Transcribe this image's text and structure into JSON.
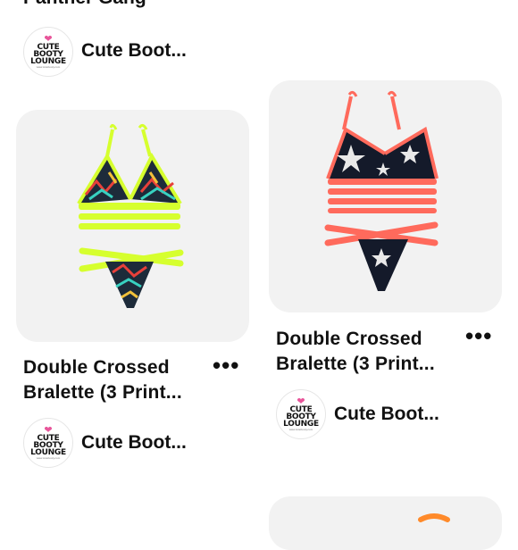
{
  "top_partial_title": "Panther Gang",
  "pins": [
    {
      "title_line1": "Double Crossed",
      "title_line2": "Bralette (3 Print...",
      "more_label": "•••",
      "accent": "#d6ff2e"
    },
    {
      "title_line1": "Double Crossed",
      "title_line2": "Bralette (3 Print...",
      "more_label": "•••",
      "accent": "#ff6a5c"
    }
  ],
  "brand": {
    "name": "Cute Boot...",
    "avatar_line1": "CUTE",
    "avatar_line2": "BOOTY",
    "avatar_line3": "LOUNGE",
    "avatar_heart": "❤",
    "avatar_url_text": "www.cutebooty.com"
  },
  "colors": {
    "card_bg": "#f2f2f2",
    "neon_yellow": "#d6ff2e",
    "neon_coral": "#ff6a5c",
    "heart_pink": "#e8559a"
  }
}
